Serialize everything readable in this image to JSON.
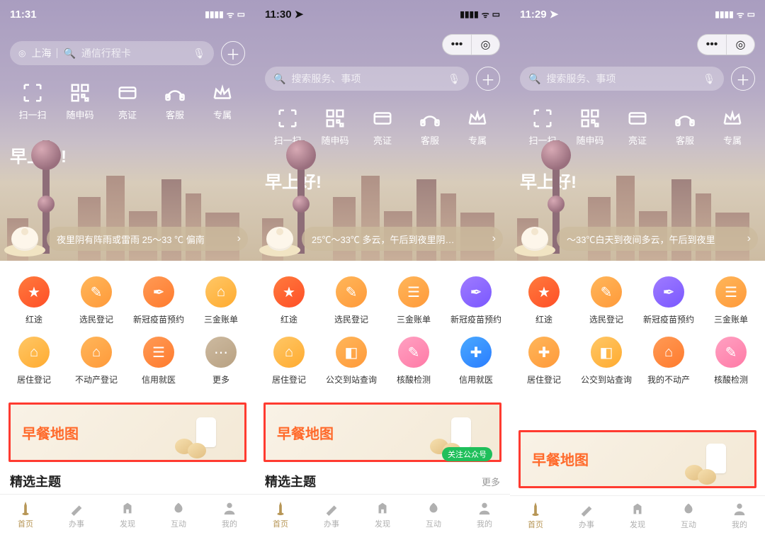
{
  "phones": [
    {
      "time": "11:31",
      "dark_status": false,
      "has_capsule": false,
      "show_follow": false,
      "location": "上海",
      "search_placeholder": "通信行程卡",
      "greeting": "早上好!",
      "weather": "夜里阴有阵雨或雷雨 25～33 ℃ 偏南",
      "services_row1": [
        {
          "label": "红途",
          "color": "red",
          "icon": "★"
        },
        {
          "label": "选民登记",
          "color": "orange",
          "icon": "✎"
        },
        {
          "label": "新冠疫苗预约",
          "color": "orange2",
          "icon": "✒"
        },
        {
          "label": "三金账单",
          "color": "yellow",
          "icon": "⌂"
        }
      ],
      "services_row2": [
        {
          "label": "居住登记",
          "color": "yellow",
          "icon": "⌂"
        },
        {
          "label": "不动产登记",
          "color": "orange",
          "icon": "⌂"
        },
        {
          "label": "信用就医",
          "color": "orange2",
          "icon": "☰"
        },
        {
          "label": "更多",
          "color": "brown",
          "icon": "⋯"
        }
      ],
      "banner_title": "早餐地图",
      "section_title": "精选主题",
      "section_more": ""
    },
    {
      "time": "11:30",
      "dark_status": true,
      "has_capsule": true,
      "show_follow": true,
      "search_placeholder": "搜索服务、事项",
      "greeting": "早上好!",
      "weather": "25℃～33℃ 多云，午后到夜里阴…",
      "services_row1": [
        {
          "label": "红途",
          "color": "red",
          "icon": "★"
        },
        {
          "label": "选民登记",
          "color": "orange",
          "icon": "✎"
        },
        {
          "label": "三金账单",
          "color": "orange",
          "icon": "☰"
        },
        {
          "label": "新冠疫苗预约",
          "color": "purple",
          "icon": "✒"
        }
      ],
      "services_row2": [
        {
          "label": "居住登记",
          "color": "yellow",
          "icon": "⌂"
        },
        {
          "label": "公交到站查询",
          "color": "orange",
          "icon": "◧"
        },
        {
          "label": "核酸检测",
          "color": "pink",
          "icon": "✎"
        },
        {
          "label": "信用就医",
          "color": "blue",
          "icon": "✚"
        }
      ],
      "banner_title": "早餐地图",
      "follow_label": "关注公众号",
      "section_title": "精选主题",
      "section_more": "更多"
    },
    {
      "time": "11:29",
      "dark_status": false,
      "has_capsule": true,
      "show_follow": false,
      "search_placeholder": "搜索服务、事项",
      "greeting": "早上好!",
      "weather": "～33℃白天到夜间多云，午后到夜里",
      "services_row1": [
        {
          "label": "红途",
          "color": "red",
          "icon": "★"
        },
        {
          "label": "选民登记",
          "color": "orange",
          "icon": "✎"
        },
        {
          "label": "新冠疫苗预约",
          "color": "purple",
          "icon": "✒"
        },
        {
          "label": "三金账单",
          "color": "orange",
          "icon": "☰"
        }
      ],
      "services_row2": [
        {
          "label": "居住登记",
          "color": "orange",
          "icon": "✚"
        },
        {
          "label": "公交到站查询",
          "color": "yellow",
          "icon": "◧"
        },
        {
          "label": "我的不动产",
          "color": "orange2",
          "icon": "⌂"
        },
        {
          "label": "核酸检测",
          "color": "pink",
          "icon": "✎"
        }
      ],
      "banner_title": "早餐地图",
      "section_title": "",
      "section_more": ""
    }
  ],
  "quick_actions": [
    {
      "label": "扫一扫",
      "name": "scan-icon"
    },
    {
      "label": "随申码",
      "name": "qrcode-icon"
    },
    {
      "label": "亮证",
      "name": "card-icon"
    },
    {
      "label": "客服",
      "name": "service-icon"
    },
    {
      "label": "专属",
      "name": "crown-icon"
    }
  ],
  "tabs": [
    {
      "label": "首页",
      "name": "tab-home",
      "active": true
    },
    {
      "label": "办事",
      "name": "tab-affairs",
      "active": false
    },
    {
      "label": "发现",
      "name": "tab-discover",
      "active": false
    },
    {
      "label": "互动",
      "name": "tab-interact",
      "active": false
    },
    {
      "label": "我的",
      "name": "tab-mine",
      "active": false
    }
  ],
  "capsule_target_label": "◎"
}
